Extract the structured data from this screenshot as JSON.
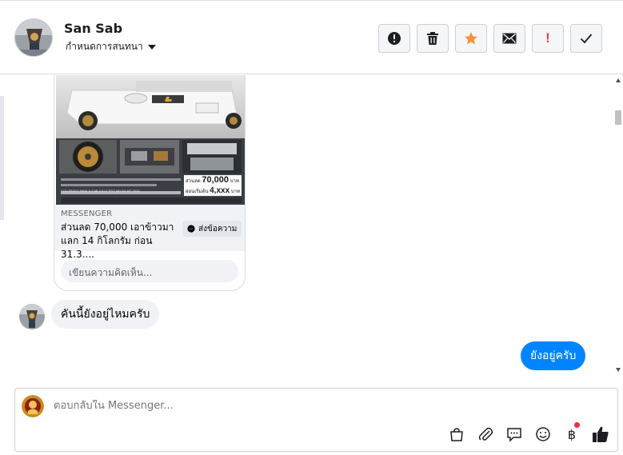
{
  "header": {
    "contact_name": "San Sab",
    "conversation_settings": "กำหนดการสนทนา"
  },
  "actions": [
    {
      "name": "report-button",
      "icon": "alert-circle-icon"
    },
    {
      "name": "delete-button",
      "icon": "trash-icon"
    },
    {
      "name": "star-button",
      "icon": "star-icon",
      "color": "#f7923b"
    },
    {
      "name": "mark-unread-button",
      "icon": "envelope-icon"
    },
    {
      "name": "mark-spam-button",
      "label": "!",
      "color": "#fa3e3e"
    },
    {
      "name": "mark-done-button",
      "icon": "check-icon"
    }
  ],
  "card": {
    "source": "MESSENGER",
    "title": "ส่วนลด 70,000 เอาข้าวมา แลก 14 กิโลกรัม ก่อน 31.3....",
    "send_label": "ส่งข้อความ",
    "comment_placeholder": "เขียนความคิดเห็น...",
    "price_small": "ส่วนลด",
    "price_value": "70,000",
    "price_unit": "บาท",
    "installment_label": "ผ่อนเริ่มต้น",
    "installment_value": "4,xxx",
    "installment_unit": "บาท",
    "model_line": "COLORADO NEW X-CAB 2.5 LT FDT (MY18) MT 2019"
  },
  "messages": [
    {
      "direction": "in",
      "text": "คันนี้ยังอยู่ไหมครับ"
    },
    {
      "direction": "out",
      "text": "ยังอยู่ครับ"
    }
  ],
  "composer": {
    "placeholder": "ตอบกลับใน Messenger..."
  },
  "colors": {
    "accent": "#0084ff",
    "star": "#f7923b",
    "spam": "#fa3e3e",
    "notify_dot": "#f02849"
  }
}
